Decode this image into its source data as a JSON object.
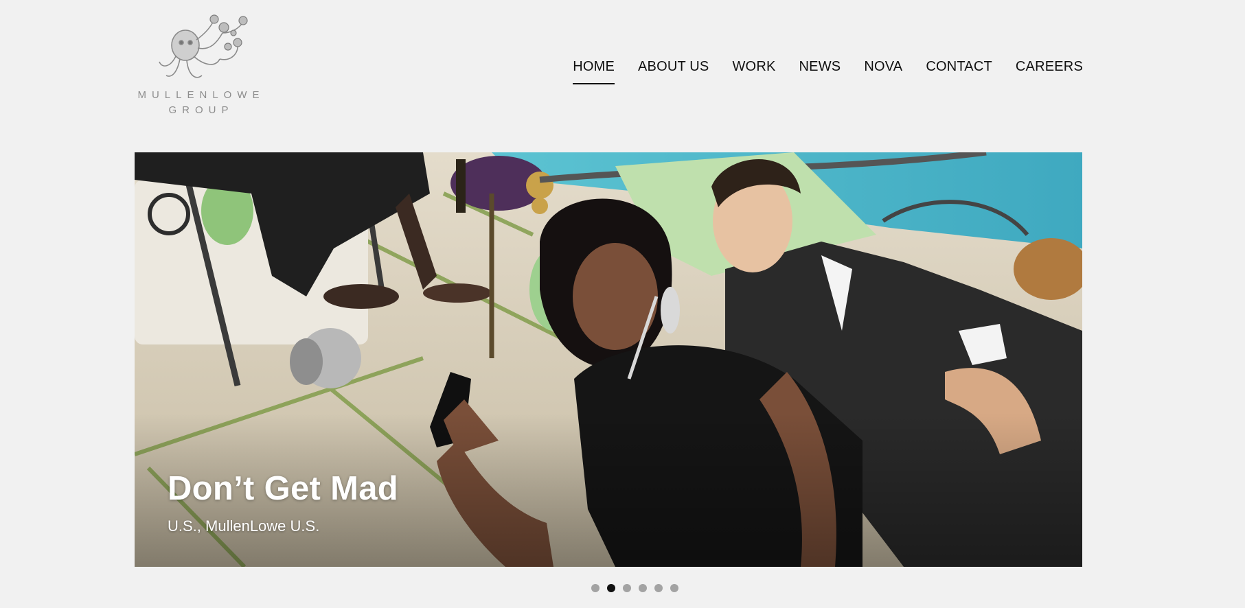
{
  "logo": {
    "line1": "MULLENLOWE",
    "line2": "GROUP",
    "icon": "octopus-logo-icon"
  },
  "nav": {
    "items": [
      {
        "label": "HOME",
        "active": true
      },
      {
        "label": "ABOUT US",
        "active": false
      },
      {
        "label": "WORK",
        "active": false
      },
      {
        "label": "NEWS",
        "active": false
      },
      {
        "label": "NOVA",
        "active": false
      },
      {
        "label": "CONTACT",
        "active": false
      },
      {
        "label": "CAREERS",
        "active": false
      }
    ]
  },
  "hero": {
    "title": "Don’t Get Mad",
    "subtitle": "U.S., MullenLowe U.S."
  },
  "carousel": {
    "slide_count": 6,
    "active_index": 1
  },
  "colors": {
    "background": "#f1f1f1",
    "text": "#111111",
    "dot_inactive": "#a3a3a3",
    "dot_active": "#111111",
    "pool": "#4fb7c9",
    "stone": "#d9cfb8"
  }
}
